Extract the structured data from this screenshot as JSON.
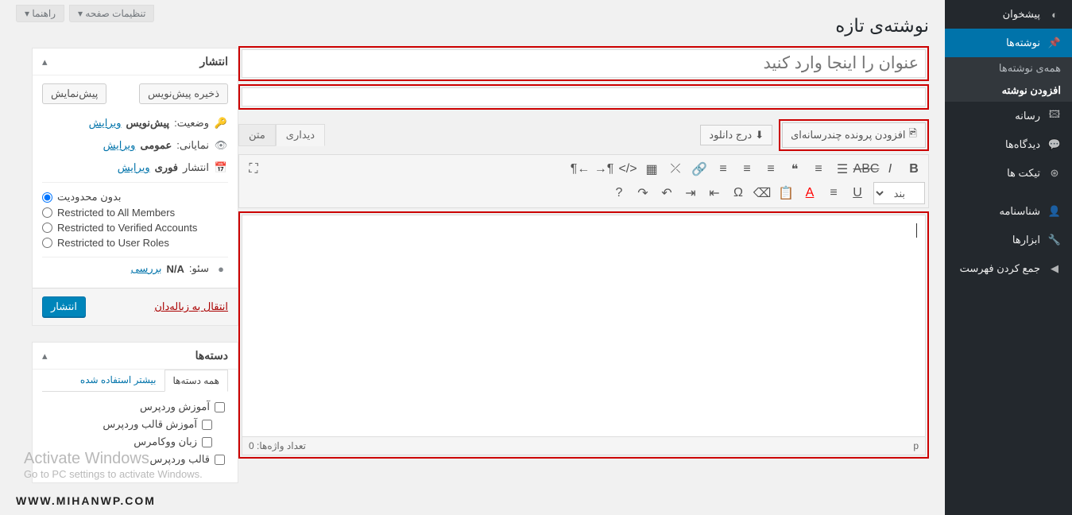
{
  "sidebar": {
    "items": [
      {
        "label": "پیشخوان",
        "icon": "dashboard"
      },
      {
        "label": "نوشته‌ها",
        "icon": "pin",
        "current": true,
        "submenu": [
          {
            "label": "همه‌ی نوشته‌ها"
          },
          {
            "label": "افزودن نوشته",
            "active": true
          }
        ]
      },
      {
        "label": "رسانه",
        "icon": "media"
      },
      {
        "label": "دیدگاه‌ها",
        "icon": "comment"
      },
      {
        "label": "تیکت ها",
        "icon": "ticket"
      },
      {
        "label": "شناسنامه",
        "icon": "user"
      },
      {
        "label": "ابزارها",
        "icon": "tool"
      },
      {
        "label": "جمع کردن فهرست",
        "icon": "collapse"
      }
    ]
  },
  "screen_opts": {
    "settings": "تنظیمات صفحه",
    "help": "راهنما"
  },
  "page": {
    "title": "نوشته‌ی تازه",
    "title_placeholder": "عنوان را اینجا وارد کنید",
    "add_media": "افزودن پرونده چندرسانه‌ای",
    "insert_download": "درج دانلود",
    "tab_visual": "دیداری",
    "tab_text": "متن",
    "paragraph": "بند",
    "word_count_label": "تعداد واژه‌ها:",
    "word_count": "0",
    "path": "p"
  },
  "publish": {
    "title": "انتشار",
    "save_draft": "ذخیره پیش‌نویس",
    "preview": "پیش‌نمایش",
    "status_label": "وضعیت:",
    "status_value": "پیش‌نویس",
    "visibility_label": "نمایانی:",
    "visibility_value": "عمومی",
    "publish_label": "انتشار",
    "publish_value": "فوری",
    "edit": "ویرایش",
    "restrictions": [
      "بدون محدودیت",
      "Restricted to All Members",
      "Restricted to Verified Accounts",
      "Restricted to User Roles"
    ],
    "seo_label": "سئو:",
    "seo_value": "N/A",
    "seo_check": "بررسی",
    "trash": "انتقال به زباله‌دان",
    "publish_btn": "انتشار"
  },
  "categories": {
    "title": "دسته‌ها",
    "tab_all": "همه دسته‌ها",
    "tab_used": "بیشتر استفاده شده",
    "items": [
      "آموزش وردپرس",
      "آموزش قالب وردپرس",
      "زبان ووکامرس",
      "قالب وردپرس"
    ]
  },
  "activate": {
    "title": "Activate Windows",
    "sub": "Go to PC settings to activate Windows."
  },
  "watermark": "WWW.MIHANWP.COM"
}
